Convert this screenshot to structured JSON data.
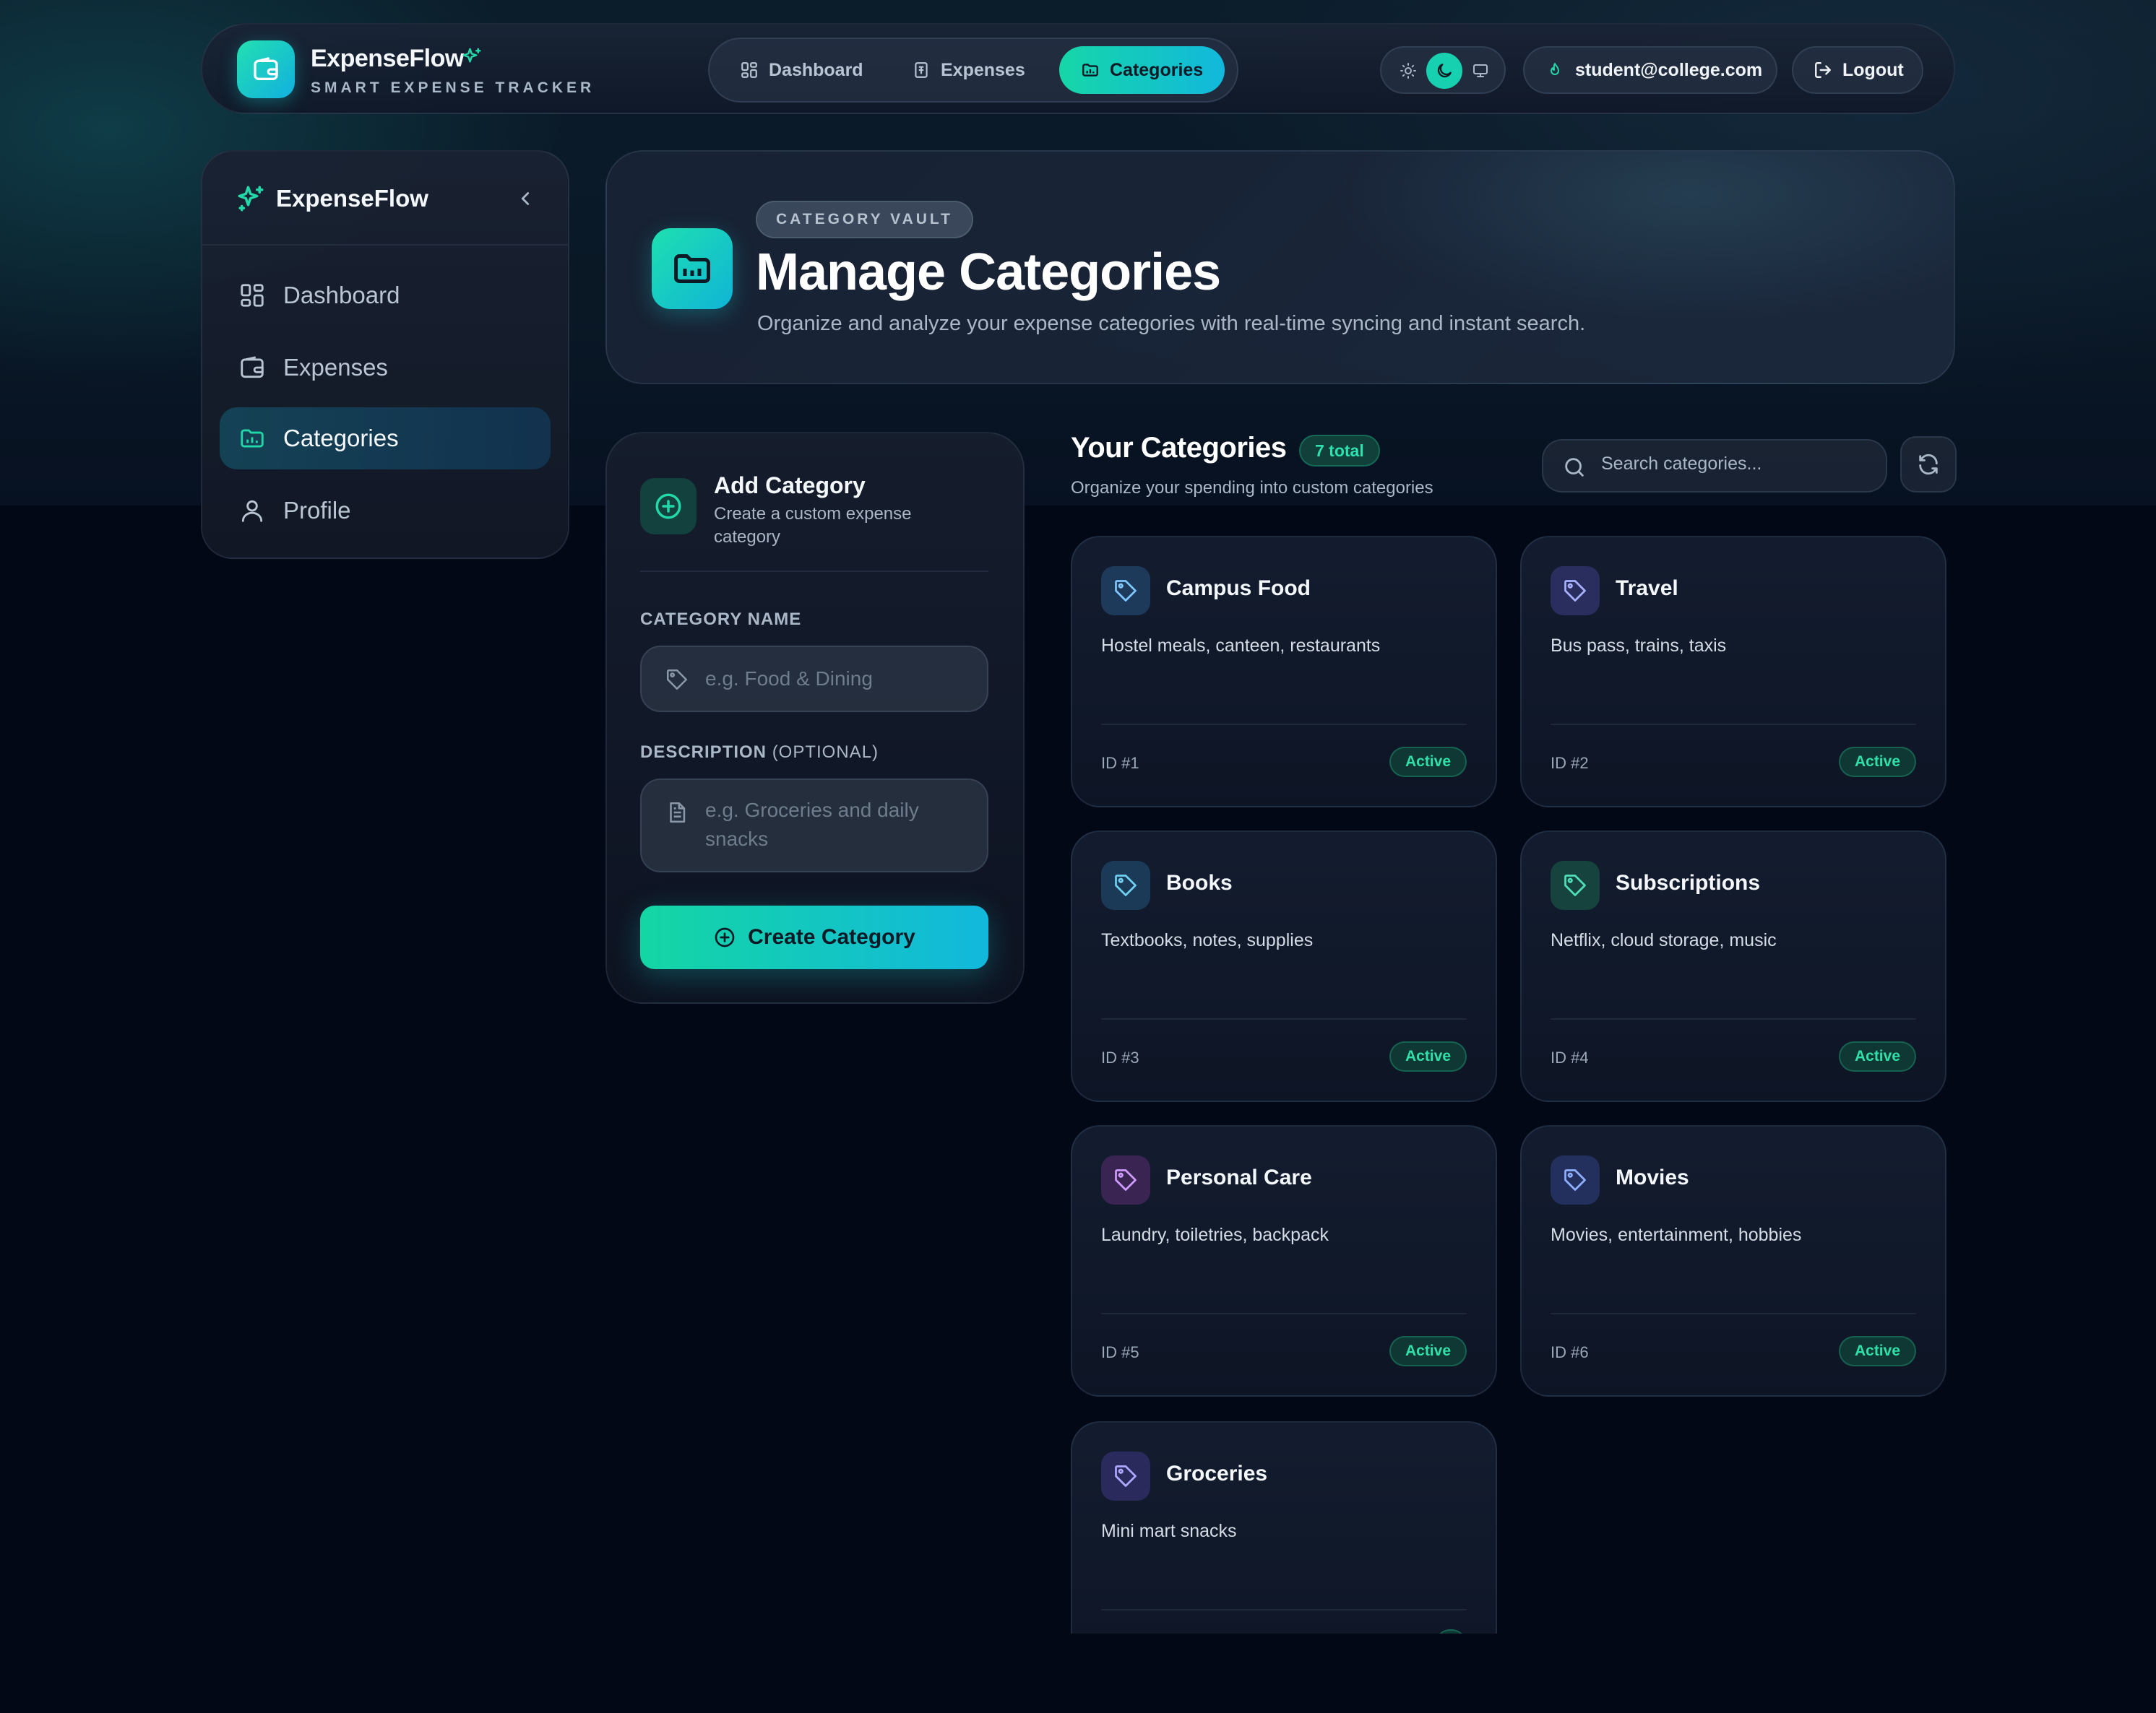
{
  "colors": {
    "accent": "#16d6a8",
    "accent_blue": "#12b8dc",
    "background": "#030817",
    "status_active": "#2fe0a8"
  },
  "header": {
    "app_name": "ExpenseFlow",
    "tagline": "SMART EXPENSE TRACKER",
    "nav": [
      {
        "label": "Dashboard",
        "icon": "dashboard-grid-icon"
      },
      {
        "label": "Expenses",
        "icon": "receipt-icon"
      },
      {
        "label": "Categories",
        "icon": "folder-chart-icon",
        "active": true
      }
    ],
    "theme_options": [
      "light",
      "dark",
      "system"
    ],
    "theme_selected": "dark",
    "user_email": "student@college.com",
    "logout_label": "Logout"
  },
  "sidebar": {
    "title": "ExpenseFlow",
    "items": [
      {
        "label": "Dashboard",
        "icon": "dashboard-grid-icon"
      },
      {
        "label": "Expenses",
        "icon": "wallet-icon"
      },
      {
        "label": "Categories",
        "icon": "folder-chart-icon",
        "active": true
      },
      {
        "label": "Profile",
        "icon": "user-icon"
      }
    ]
  },
  "hero": {
    "chip": "CATEGORY VAULT",
    "title": "Manage Categories",
    "subtitle": "Organize and analyze your expense categories with real-time syncing and instant search."
  },
  "form": {
    "title": "Add Category",
    "subtitle": "Create a custom expense category",
    "name_label": "CATEGORY NAME",
    "name_placeholder": "e.g. Food & Dining",
    "desc_label": "DESCRIPTION",
    "desc_label_optional": "(OPTIONAL)",
    "desc_placeholder": "e.g. Groceries and daily snacks",
    "submit_label": "Create Category"
  },
  "categories": {
    "title": "Your Categories",
    "count_label": "7 total",
    "subtitle": "Organize your spending into custom categories",
    "search_placeholder": "Search categories...",
    "items": [
      {
        "name": "Campus Food",
        "description": "Hostel meals, canteen, restaurants",
        "id_label": "ID #1",
        "status": "Active",
        "tint": "#1d3a5a"
      },
      {
        "name": "Travel",
        "description": "Bus pass, trains, taxis",
        "id_label": "ID #2",
        "status": "Active",
        "tint": "#2a2e5e"
      },
      {
        "name": "Books",
        "description": "Textbooks, notes, supplies",
        "id_label": "ID #3",
        "status": "Active",
        "tint": "#1a3a58"
      },
      {
        "name": "Subscriptions",
        "description": "Netflix, cloud storage, music",
        "id_label": "ID #4",
        "status": "Active",
        "tint": "#17433e"
      },
      {
        "name": "Personal Care",
        "description": "Laundry, toiletries, backpack",
        "id_label": "ID #5",
        "status": "Active",
        "tint": "#3a2552"
      },
      {
        "name": "Movies",
        "description": "Movies, entertainment, hobbies",
        "id_label": "ID #6",
        "status": "Active",
        "tint": "#23305e"
      },
      {
        "name": "Groceries",
        "description": "Mini mart snacks",
        "id_label": "",
        "status": "",
        "tint": "#2a2a5c"
      }
    ]
  }
}
